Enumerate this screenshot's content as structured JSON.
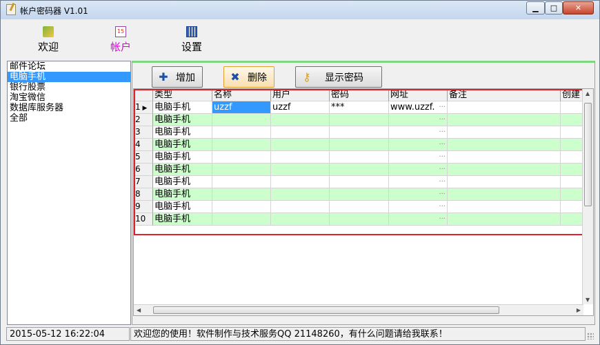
{
  "window": {
    "title": "帐户密码器 V1.01"
  },
  "toolbar": {
    "tabs": [
      {
        "label": "欢迎",
        "icon": "welcome-icon"
      },
      {
        "label": "帐户",
        "icon": "calendar-icon",
        "badge": "15"
      },
      {
        "label": "设置",
        "icon": "settings-grid-icon"
      }
    ]
  },
  "sidebar": {
    "items": [
      {
        "label": "邮件论坛"
      },
      {
        "label": "电脑手机"
      },
      {
        "label": "银行股票"
      },
      {
        "label": "淘宝微信"
      },
      {
        "label": "数据库服务器"
      },
      {
        "label": "全部"
      }
    ],
    "selected": "电脑手机"
  },
  "actions": {
    "add_label": "增加",
    "delete_label": "删除",
    "show_password_label": "显示密码"
  },
  "grid": {
    "columns": [
      "类型",
      "名称",
      "用户",
      "密码",
      "网址",
      "备注",
      "创建"
    ],
    "rows": [
      {
        "num": "1",
        "type": "电脑手机",
        "name": "uzzf",
        "user": "uzzf",
        "password": "***",
        "url": "www.uzzf.",
        "note": ""
      },
      {
        "num": "2",
        "type": "电脑手机",
        "name": "",
        "user": "",
        "password": "",
        "url": "",
        "note": ""
      },
      {
        "num": "3",
        "type": "电脑手机",
        "name": "",
        "user": "",
        "password": "",
        "url": "",
        "note": ""
      },
      {
        "num": "4",
        "type": "电脑手机",
        "name": "",
        "user": "",
        "password": "",
        "url": "",
        "note": ""
      },
      {
        "num": "5",
        "type": "电脑手机",
        "name": "",
        "user": "",
        "password": "",
        "url": "",
        "note": ""
      },
      {
        "num": "6",
        "type": "电脑手机",
        "name": "",
        "user": "",
        "password": "",
        "url": "",
        "note": ""
      },
      {
        "num": "7",
        "type": "电脑手机",
        "name": "",
        "user": "",
        "password": "",
        "url": "",
        "note": ""
      },
      {
        "num": "8",
        "type": "电脑手机",
        "name": "",
        "user": "",
        "password": "",
        "url": "",
        "note": ""
      },
      {
        "num": "9",
        "type": "电脑手机",
        "name": "",
        "user": "",
        "password": "",
        "url": "",
        "note": ""
      },
      {
        "num": "10",
        "type": "电脑手机",
        "name": "",
        "user": "",
        "password": "",
        "url": "",
        "note": ""
      }
    ]
  },
  "status": {
    "datetime": "2015-05-12 16:22:04",
    "message": "欢迎您的使用！软件制作与技术服务QQ 21148260，有什么问题请给我联系！"
  },
  "colors": {
    "highlight": "#3399ff",
    "row_alt": "#ccffcc",
    "frame_red": "#e0202a",
    "account_tab": "#e000e0"
  }
}
